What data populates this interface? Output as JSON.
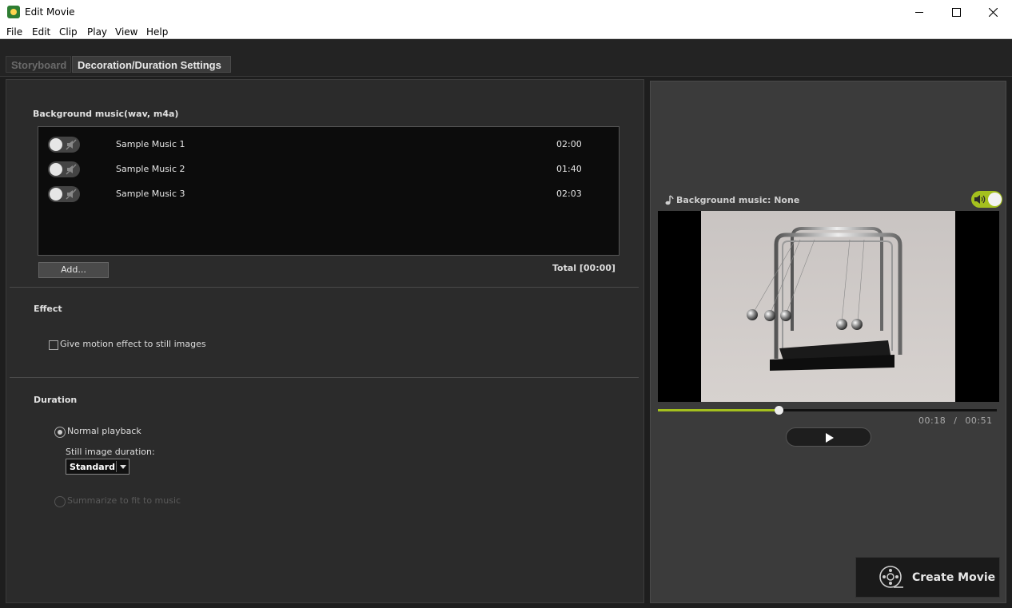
{
  "window": {
    "title": "Edit Movie"
  },
  "menu": {
    "items": [
      "File",
      "Edit",
      "Clip",
      "Play",
      "View",
      "Help"
    ]
  },
  "tabs": [
    {
      "label": "Storyboard",
      "active": false
    },
    {
      "label": "Decoration/Duration Settings",
      "active": true
    }
  ],
  "background_music": {
    "title": "Background music(wav, m4a)",
    "tracks": [
      {
        "name": "Sample Music 1",
        "duration": "02:00",
        "enabled": false
      },
      {
        "name": "Sample Music 2",
        "duration": "01:40",
        "enabled": false
      },
      {
        "name": "Sample Music 3",
        "duration": "02:03",
        "enabled": false
      }
    ],
    "add_label": "Add...",
    "total": "Total [00:00]"
  },
  "effect": {
    "title": "Effect",
    "motion_label": "Give motion effect to still images",
    "motion_checked": false
  },
  "duration": {
    "title": "Duration",
    "normal_label": "Normal playback",
    "still_label": "Still image duration:",
    "still_value": "Standard",
    "summarize_label": "Summarize to fit to music"
  },
  "preview": {
    "bgm_label": "Background music: None",
    "bgm_enabled": true,
    "progress": 0.356,
    "time_current": "00:18",
    "time_total": "00:51",
    "time_separator": "/"
  },
  "create_movie_label": "Create Movie",
  "colors": {
    "accent": "#a4c01e",
    "panel_bg": "#2b2b2b",
    "preview_bg": "#3b3b3b"
  }
}
